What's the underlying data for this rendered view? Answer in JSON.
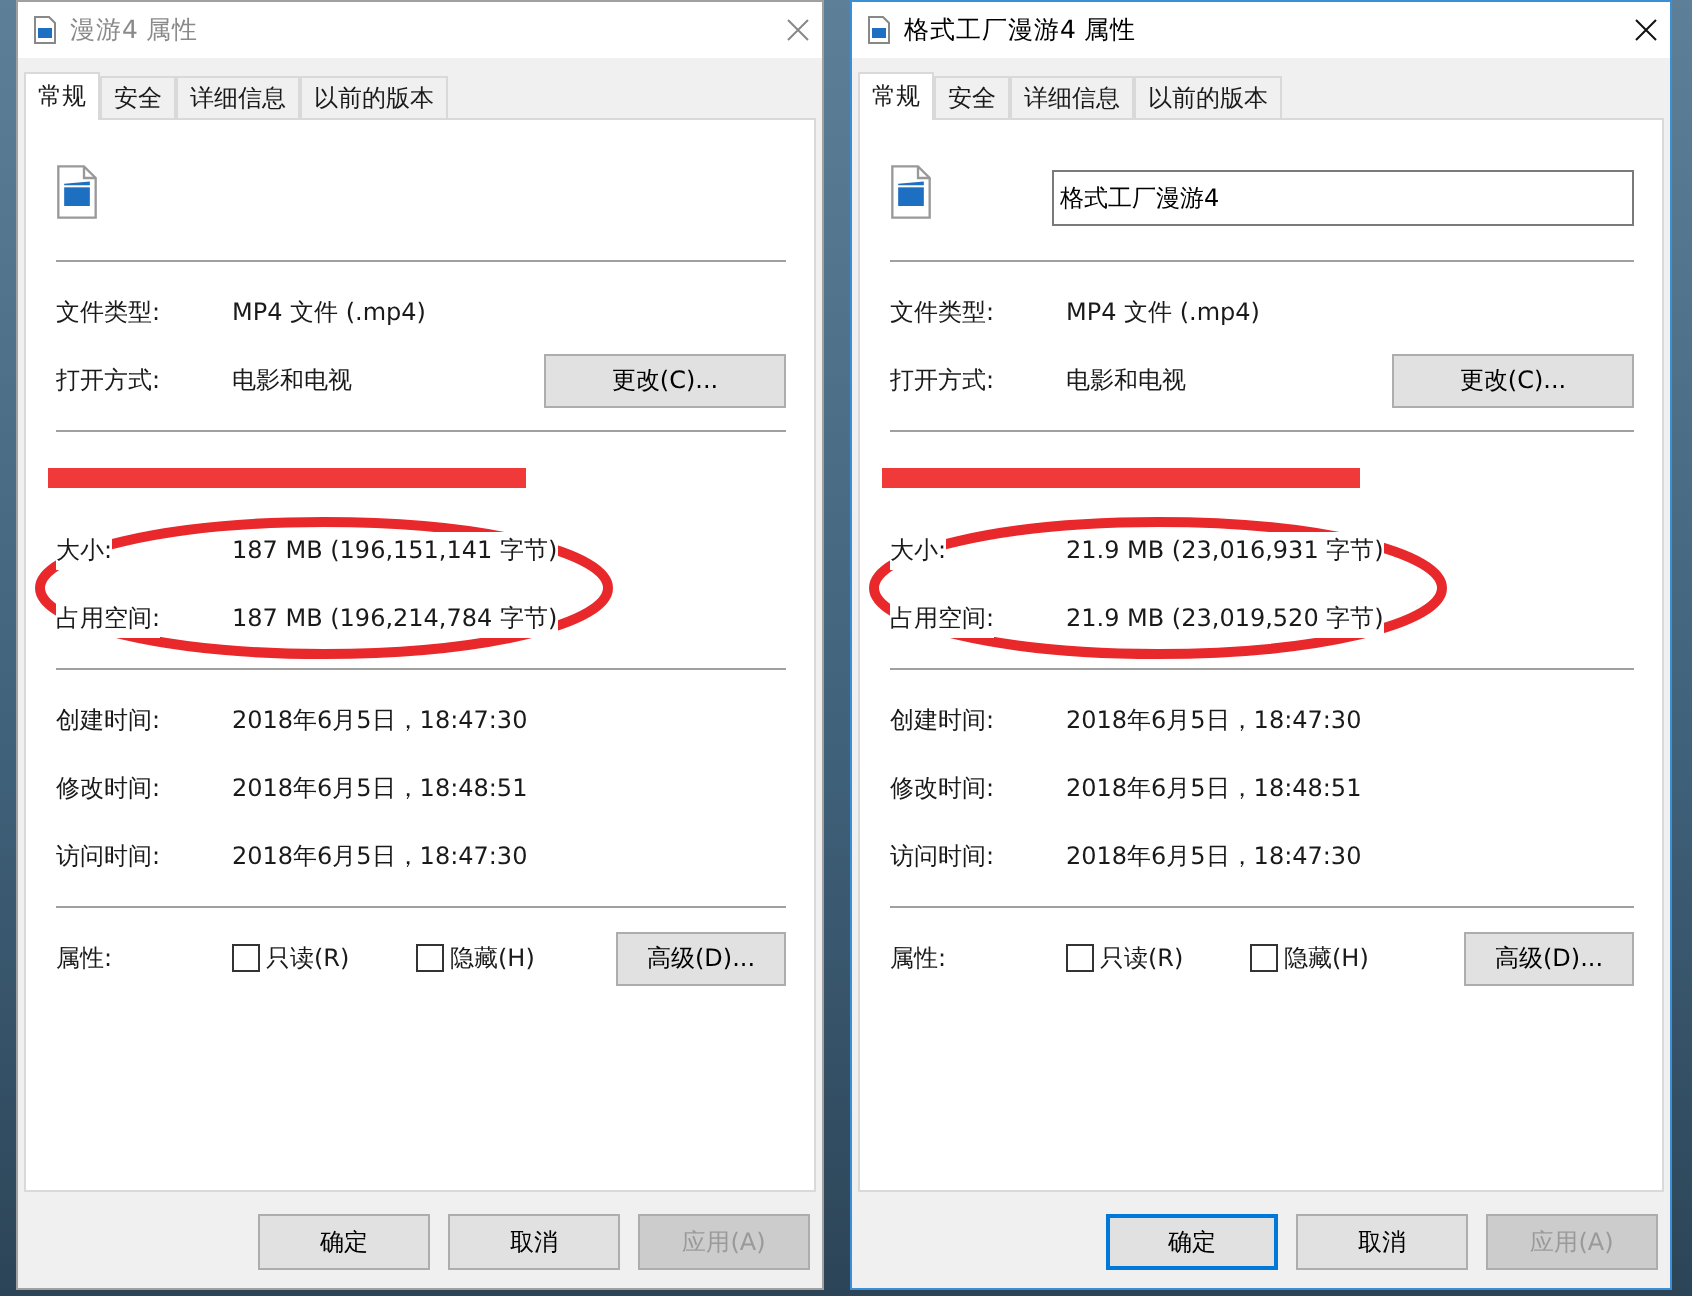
{
  "dialogs": [
    {
      "title": "漫游4 属性",
      "active": false,
      "tabs": [
        {
          "label": "常规",
          "selected": true
        },
        {
          "label": "安全",
          "selected": false
        },
        {
          "label": "详细信息",
          "selected": false
        },
        {
          "label": "以前的版本",
          "selected": false
        }
      ],
      "type_rows": [
        {
          "label": "文件类型:",
          "value": "MP4 文件 (.mp4)"
        },
        {
          "label": "打开方式:",
          "value": "电影和电视",
          "button": "更改(C)..."
        }
      ],
      "location": {
        "redacted": true
      },
      "size_rows": [
        {
          "label": "大小:",
          "value": "187 MB (196,151,141 字节)"
        },
        {
          "label": "占用空间:",
          "value": "187 MB (196,214,784 字节)"
        }
      ],
      "circled": true,
      "time_rows": [
        {
          "label": "创建时间:",
          "value": "2018年6月5日，18:47:30"
        },
        {
          "label": "修改时间:",
          "value": "2018年6月5日，18:48:51"
        },
        {
          "label": "访问时间:",
          "value": "2018年6月5日，18:47:30"
        }
      ],
      "attributes": {
        "label": "属性:",
        "checkboxes": [
          {
            "label": "只读(R)",
            "checked": false
          },
          {
            "label": "隐藏(H)",
            "checked": false
          }
        ],
        "button": "高级(D)..."
      },
      "buttons": [
        {
          "label": "确定",
          "focused": false,
          "disabled": false
        },
        {
          "label": "取消",
          "focused": false,
          "disabled": false
        },
        {
          "label": "应用(A)",
          "focused": false,
          "disabled": true
        }
      ]
    },
    {
      "title": "格式工厂漫游4 属性",
      "active": true,
      "tabs": [
        {
          "label": "常规",
          "selected": true
        },
        {
          "label": "安全",
          "selected": false
        },
        {
          "label": "详细信息",
          "selected": false
        },
        {
          "label": "以前的版本",
          "selected": false
        }
      ],
      "name_field": {
        "value": "格式工厂漫游4"
      },
      "type_rows": [
        {
          "label": "文件类型:",
          "value": "MP4 文件 (.mp4)"
        },
        {
          "label": "打开方式:",
          "value": "电影和电视",
          "button": "更改(C)..."
        }
      ],
      "location": {
        "redacted": true
      },
      "size_rows": [
        {
          "label": "大小:",
          "value": "21.9 MB (23,016,931 字节)"
        },
        {
          "label": "占用空间:",
          "value": "21.9 MB (23,019,520 字节)"
        }
      ],
      "circled": true,
      "time_rows": [
        {
          "label": "创建时间:",
          "value": "2018年6月5日，18:47:30"
        },
        {
          "label": "修改时间:",
          "value": "2018年6月5日，18:48:51"
        },
        {
          "label": "访问时间:",
          "value": "2018年6月5日，18:47:30"
        }
      ],
      "attributes": {
        "label": "属性:",
        "checkboxes": [
          {
            "label": "只读(R)",
            "checked": false
          },
          {
            "label": "隐藏(H)",
            "checked": false
          }
        ],
        "button": "高级(D)..."
      },
      "buttons": [
        {
          "label": "确定",
          "focused": true,
          "disabled": false
        },
        {
          "label": "取消",
          "focused": false,
          "disabled": false
        },
        {
          "label": "应用(A)",
          "focused": false,
          "disabled": true
        }
      ]
    }
  ]
}
